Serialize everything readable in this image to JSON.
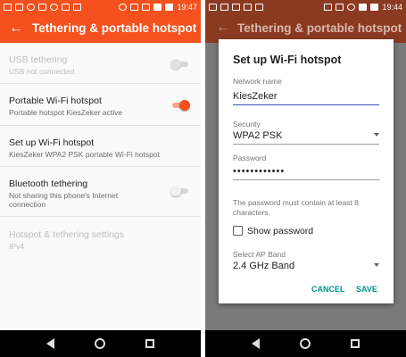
{
  "status_left": {
    "time": "19:47"
  },
  "status_right": {
    "time": "19:44"
  },
  "toolbar": {
    "back_glyph": "←",
    "title": "Tethering & portable hotspot"
  },
  "settings": [
    {
      "title": "USB tethering",
      "subtitle": "USB not connected",
      "switch": "off",
      "enabled": false
    },
    {
      "title": "Portable Wi-Fi hotspot",
      "subtitle": "Portable hotspot KiesZeker active",
      "switch": "on",
      "enabled": true
    },
    {
      "title": "Set up Wi-Fi hotspot",
      "subtitle": "KiesZeker WPA2 PSK portable Wi-Fi hotspot",
      "enabled": true
    },
    {
      "title": "Bluetooth tethering",
      "subtitle": "Not sharing this phone's Internet connection",
      "switch": "off",
      "enabled": true
    },
    {
      "title": "Hotspot & tethering settings",
      "subtitle": "IPv4",
      "enabled": false
    }
  ],
  "dialog": {
    "title": "Set up Wi-Fi hotspot",
    "network_name_label": "Network name",
    "network_name_value": "KiesZeker",
    "security_label": "Security",
    "security_value": "WPA2 PSK",
    "password_label": "Password",
    "password_value": "••••••••••••",
    "password_hint": "The password must contain at least 8 characters.",
    "show_password_label": "Show password",
    "show_password_checked": false,
    "ap_band_label": "Select AP Band",
    "ap_band_value": "2.4 GHz Band",
    "cancel_label": "CANCEL",
    "save_label": "SAVE"
  },
  "colors": {
    "accent": "#f4511e",
    "dialog_button": "#009688",
    "nav_bar": "#000000"
  }
}
